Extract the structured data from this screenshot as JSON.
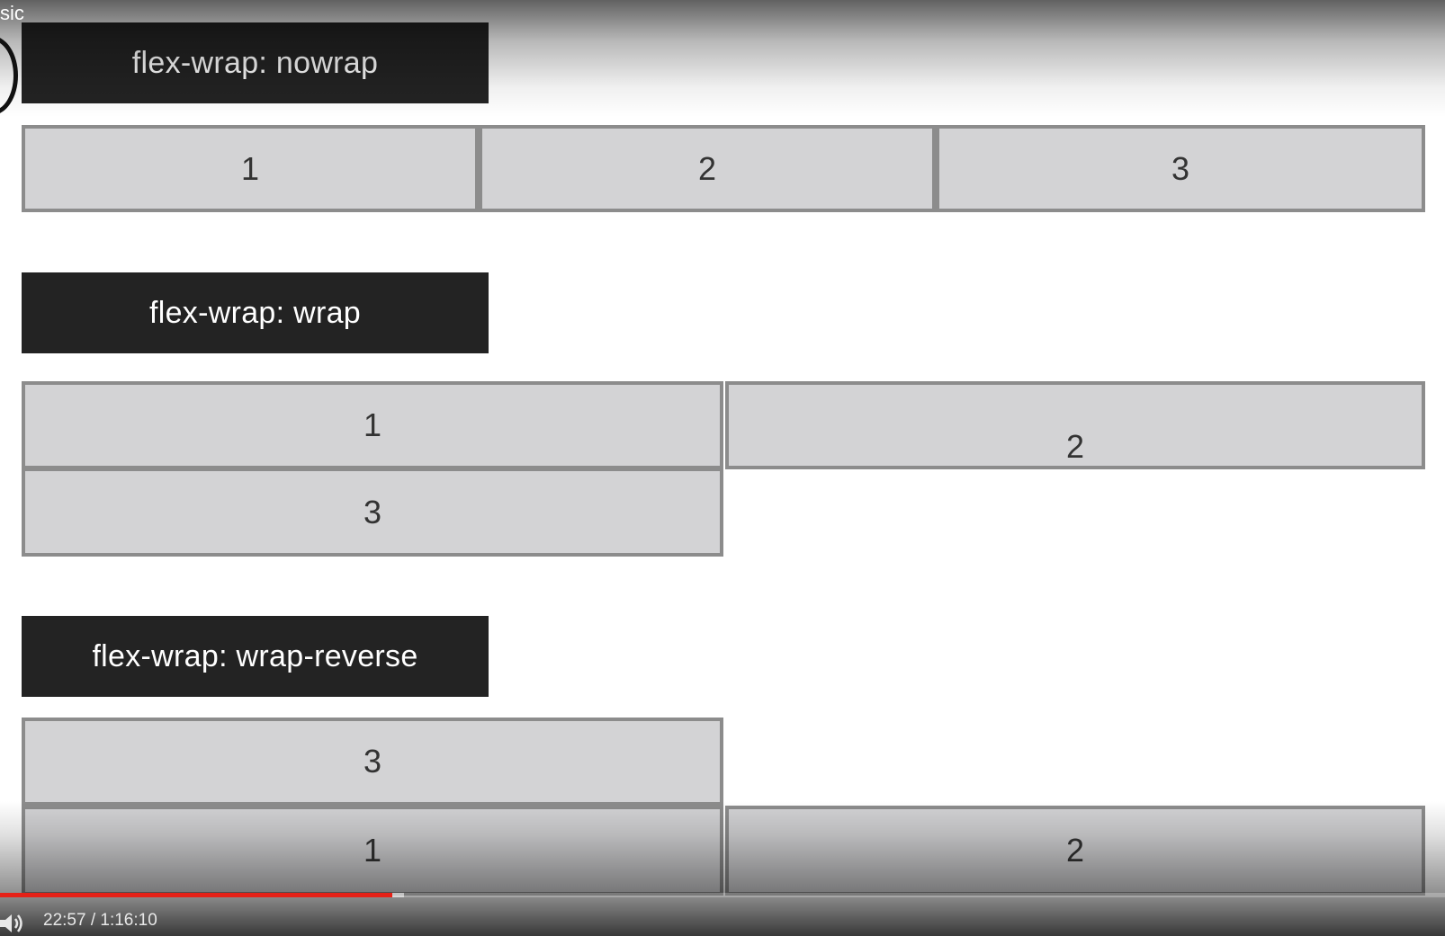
{
  "video": {
    "title_fragment": "sic",
    "current_time": "22:57",
    "separator": " / ",
    "duration": "1:16:10",
    "progress_fraction": 0.2717,
    "buffered_fraction": 0.2795,
    "progress_color": "#e62117"
  },
  "sections": [
    {
      "label": "flex-wrap: nowrap",
      "items": [
        "1",
        "2",
        "3"
      ]
    },
    {
      "label": "flex-wrap: wrap",
      "items": [
        "1",
        "2",
        "3"
      ]
    },
    {
      "label": "flex-wrap: wrap-reverse",
      "items": [
        "3",
        "1",
        "2"
      ]
    }
  ],
  "colors": {
    "label_bg": "#232323",
    "box_bg": "#d3d3d5",
    "box_border": "#8c8c8c"
  },
  "icons": {
    "volume": "volume-icon"
  }
}
